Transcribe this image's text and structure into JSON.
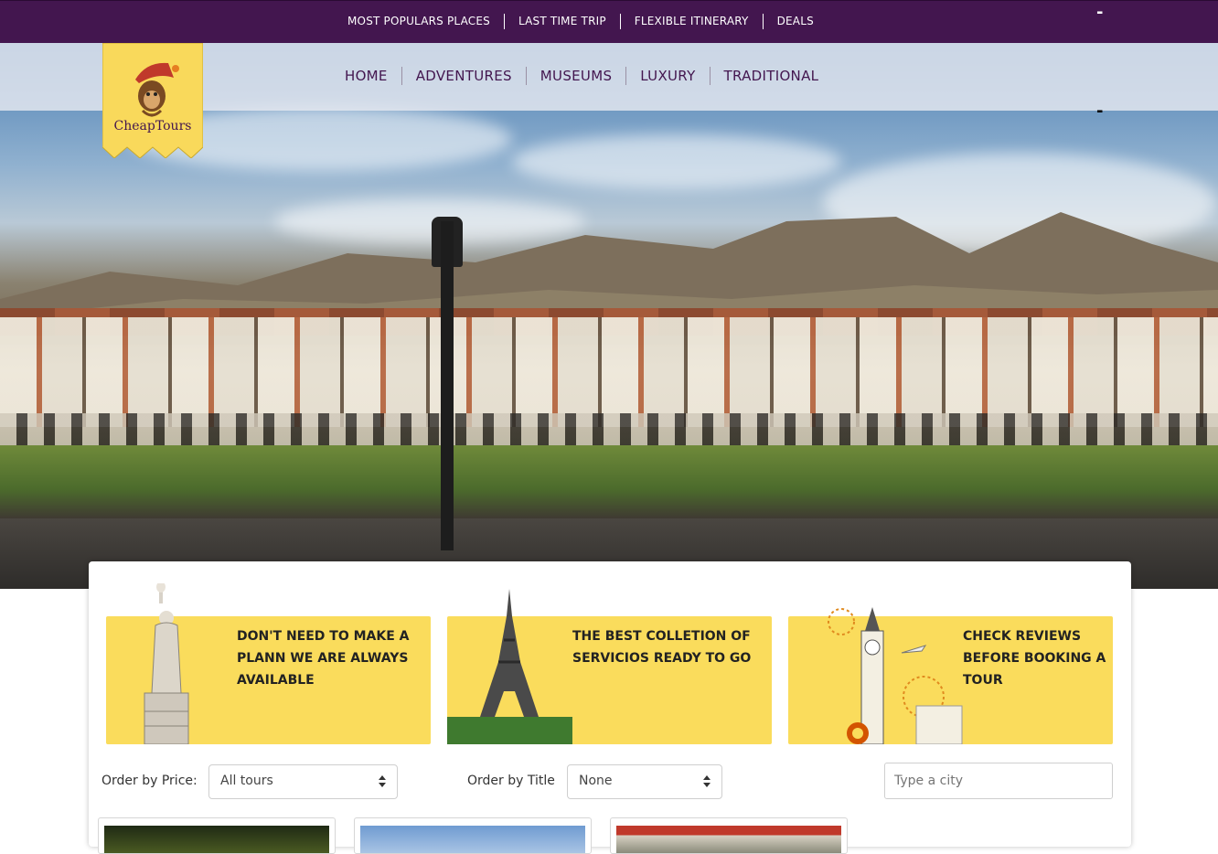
{
  "topbar": {
    "links": [
      {
        "label": "MOST POPULARS PLACES"
      },
      {
        "label": "LAST TIME TRIP"
      },
      {
        "label": "FLEXIBLE ITINERARY"
      },
      {
        "label": "DEALS"
      }
    ],
    "toggle_label": "-"
  },
  "navbar": {
    "links": [
      {
        "label": "HOME"
      },
      {
        "label": "ADVENTURES"
      },
      {
        "label": "MUSEUMS"
      },
      {
        "label": "LUXURY"
      },
      {
        "label": "TRADITIONAL"
      }
    ],
    "toggle_label": "-"
  },
  "logo": {
    "text": "CheapTours",
    "icon": "monkey-mascot-icon"
  },
  "features": [
    {
      "text": "DON'T NEED TO MAKE A PLANN WE ARE ALWAYS AVAILABLE",
      "icon": "statue-of-liberty-icon"
    },
    {
      "text": "THE BEST COLLETION OF SERVICIOS READY TO GO",
      "icon": "eiffel-tower-icon"
    },
    {
      "text": "CHECK REVIEWS BEFORE BOOKING A TOUR",
      "icon": "big-ben-icon"
    }
  ],
  "filters": {
    "price_label": "Order by Price:",
    "price_value": "All tours",
    "title_label": "Order by Title",
    "title_value": "None",
    "city_placeholder": "Type a city"
  },
  "colors": {
    "brand_purple": "#43164f",
    "feature_yellow": "#fadc5c"
  }
}
